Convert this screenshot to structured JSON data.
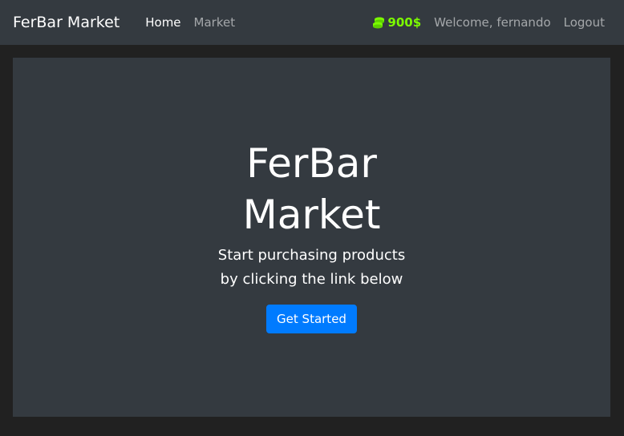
{
  "navbar": {
    "brand": "FerBar Market",
    "links": [
      {
        "label": "Home",
        "active": true
      },
      {
        "label": "Market",
        "active": false
      }
    ],
    "budget": "900$",
    "welcome": "Welcome, fernando",
    "logout": "Logout",
    "colors": {
      "budget": "#7cfc00",
      "background": "#343a40"
    }
  },
  "hero": {
    "title": "FerBar Market",
    "subtitle": "Start purchasing products by clicking the link below",
    "button": "Get Started",
    "colors": {
      "button": "#007bff"
    }
  }
}
